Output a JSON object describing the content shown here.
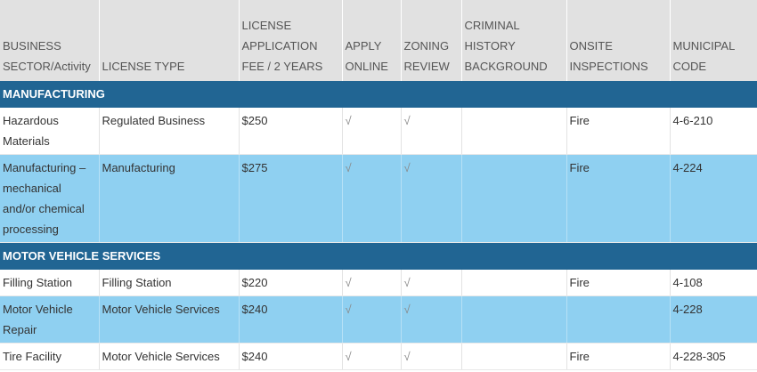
{
  "headers": [
    "BUSINESS SECTOR/Activity",
    "LICENSE TYPE",
    "LICENSE APPLICATION FEE / 2 YEARS",
    "APPLY ONLINE",
    "ZONING REVIEW",
    "CRIMINAL HISTORY BACKGROUND",
    "ONSITE INSPECTIONS",
    "MUNICIPAL CODE"
  ],
  "sections": [
    {
      "title": "MANUFACTURING",
      "rows": [
        {
          "sector": "Hazardous Materials",
          "license_type": "Regulated Business",
          "fee": "$250",
          "apply_online": "√",
          "zoning_review": "√",
          "criminal_history": "",
          "onsite_inspections": "Fire",
          "municipal_code": "4-6-210"
        },
        {
          "sector": "Manufacturing – mechanical and/or chemical processing",
          "license_type": "Manufacturing",
          "fee": "$275",
          "apply_online": "√",
          "zoning_review": "√",
          "criminal_history": "",
          "onsite_inspections": "Fire",
          "municipal_code": "4-224"
        }
      ]
    },
    {
      "title": "MOTOR VEHICLE SERVICES",
      "rows": [
        {
          "sector": "Filling Station",
          "license_type": "Filling Station",
          "fee": "$220",
          "apply_online": "√",
          "zoning_review": "√",
          "criminal_history": "",
          "onsite_inspections": "Fire",
          "municipal_code": "4-108"
        },
        {
          "sector": "Motor Vehicle Repair",
          "license_type": "Motor Vehicle Services",
          "fee": "$240",
          "apply_online": "√",
          "zoning_review": "√",
          "criminal_history": "",
          "onsite_inspections": "",
          "municipal_code": "4-228"
        },
        {
          "sector": "Tire Facility",
          "license_type": "Motor Vehicle Services",
          "fee": "$240",
          "apply_online": "√",
          "zoning_review": "√",
          "criminal_history": "",
          "onsite_inspections": "Fire",
          "municipal_code": "4-228-305"
        }
      ]
    }
  ]
}
